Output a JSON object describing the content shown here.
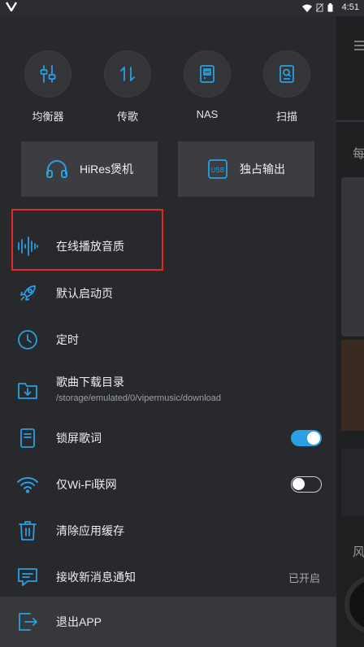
{
  "status_bar": {
    "time": "4:51"
  },
  "quick_actions": [
    {
      "label": "均衡器",
      "icon": "equalizer-icon"
    },
    {
      "label": "传歌",
      "icon": "transfer-icon"
    },
    {
      "label": "NAS",
      "icon": "nas-icon"
    },
    {
      "label": "扫描",
      "icon": "scan-icon"
    }
  ],
  "big_buttons": [
    {
      "label": "HiRes煲机",
      "icon": "headphones-icon"
    },
    {
      "label": "独占输出",
      "icon": "usb-icon"
    }
  ],
  "menu": {
    "online_quality": "在线播放音质",
    "default_page": "默认启动页",
    "timer": "定时",
    "download_dir": "歌曲下载目录",
    "download_path": "/storage/emulated/0/vipermusic/download",
    "lockscreen_lyrics": "锁屏歌词",
    "lockscreen_lyrics_on": true,
    "wifi_only": "仅Wi-Fi联网",
    "wifi_only_on": false,
    "clear_cache": "清除应用缓存",
    "notifications": "接收新消息通知",
    "notifications_status": "已开启",
    "exit": "退出APP"
  },
  "background": {
    "glyph1": "每",
    "glyph2": "风"
  },
  "colors": {
    "accent": "#2a9fe3",
    "highlight_border": "#e32828"
  }
}
